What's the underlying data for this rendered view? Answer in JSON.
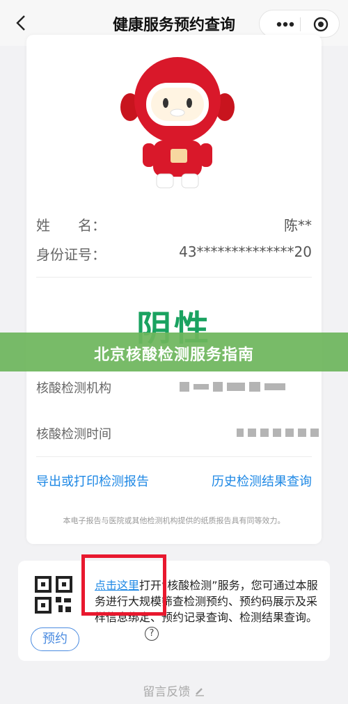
{
  "header": {
    "title": "健康服务预约查询",
    "back_icon": "chevron-left-icon",
    "more_icon": "more-dots-icon",
    "close_icon": "target-icon"
  },
  "profile": {
    "name_label": "姓　　名：",
    "name_value": "陈**",
    "id_label": "身份证号：",
    "id_value": "43**************20"
  },
  "result": {
    "text": "阴性",
    "color": "#1aa260"
  },
  "banner": {
    "text": "北京核酸检测服务指南",
    "color": "#6eb65c"
  },
  "test": {
    "institution_label": "核酸检测机构",
    "time_label": "核酸检测时间"
  },
  "links": {
    "export": "导出或打印检测报告",
    "history": "历史检测结果查询"
  },
  "disclaimer": "本电子报告与医院或其他检测机构提供的纸质报告具有同等效力。",
  "service": {
    "click_here": "点击这里",
    "description": "打开“核酸检测”服务，您可通过本服务进行大规模筛查检测预约、预约码展示及采样信息绑定、预约记录查询、检测结果查询。",
    "book_button": "预约",
    "help_icon": "?"
  },
  "footer": {
    "feedback": "留言反馈"
  },
  "colors": {
    "link": "#1e88e5",
    "highlight_box": "#e8182e"
  }
}
